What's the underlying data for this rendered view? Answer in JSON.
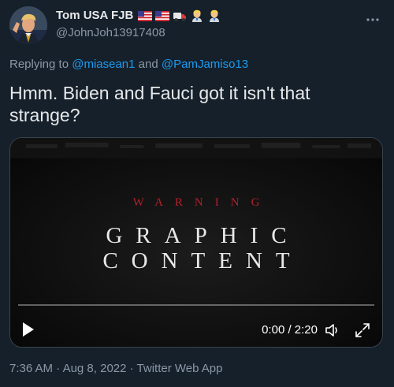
{
  "author": {
    "display_name": "Tom USA FJB",
    "handle": "@JohnJoh13917408",
    "name_emojis": [
      "us-flag",
      "us-flag",
      "truck",
      "person-blond",
      "person-blond"
    ]
  },
  "reply": {
    "prefix": "Replying to ",
    "mention1": "@miasean1",
    "conjunction": " and ",
    "mention2": "@PamJamiso13"
  },
  "tweet": {
    "text": "Hmm. Biden and Fauci got it isn't that strange?"
  },
  "video": {
    "overlay_warning": "WARNING",
    "overlay_line1": "GRAPHIC",
    "overlay_line2": "CONTENT",
    "time_display": "0:00 / 2:20",
    "progress": 0.0
  },
  "meta": {
    "time": "7:36 AM",
    "separator1": " · ",
    "date": "Aug 8, 2022",
    "separator2": " · ",
    "source": "Twitter Web App"
  },
  "colors": {
    "background": "#15202b",
    "accent": "#1d9bf0",
    "secondary_text": "#8b98a5",
    "warning_red": "#b3202a"
  }
}
